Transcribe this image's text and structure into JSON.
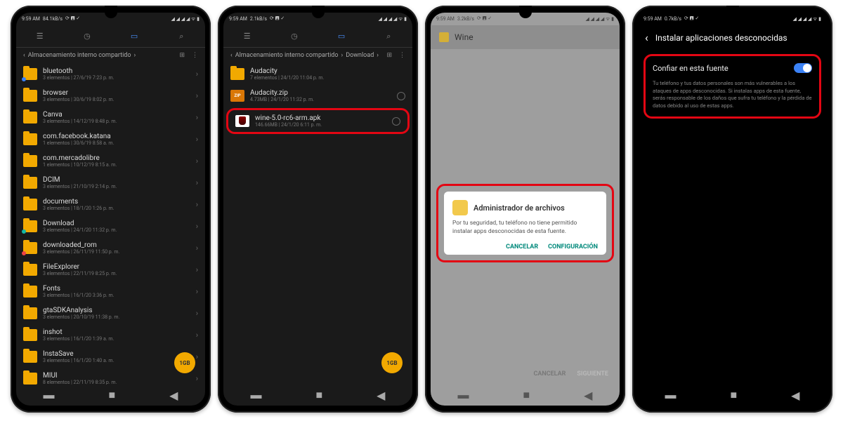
{
  "status": {
    "time": "9:59 AM",
    "net1": "84.1kB/s",
    "net2": "2.1kB/s",
    "net3": "3.2kB/s",
    "net4": "0.7kB/s"
  },
  "breadcrumb": {
    "arrow": "‹",
    "root": "Almacenamiento interno compartido",
    "chev": "›",
    "download": "Download"
  },
  "p1_list": [
    {
      "name": "bluetooth",
      "meta": "3 elementos | 27/6/19 7:23 p. m.",
      "badge": "blue"
    },
    {
      "name": "browser",
      "meta": "3 elementos | 30/6/19 8:02 p. m."
    },
    {
      "name": "Canva",
      "meta": "3 elementos | 14/12/19 8:48 p. m."
    },
    {
      "name": "com.facebook.katana",
      "meta": "1 elementos | 30/6/19 8:58 a. m."
    },
    {
      "name": "com.mercadolibre",
      "meta": "1 elementos | 10/12/19 8:15 a. m."
    },
    {
      "name": "DCIM",
      "meta": "3 elementos | 21/10/19 2:14 p. m."
    },
    {
      "name": "documents",
      "meta": "3 elementos | 18/1/20 1:26 p. m."
    },
    {
      "name": "Download",
      "meta": "3 elementos | 24/1/20 11:32 p. m.",
      "badge": "teal"
    },
    {
      "name": "downloaded_rom",
      "meta": "3 elementos | 26/11/19 11:50 p. m.",
      "badge": "red"
    },
    {
      "name": "FileExplorer",
      "meta": "3 elementos | 22/11/19 8:25 p. m."
    },
    {
      "name": "Fonts",
      "meta": "3 elementos | 16/1/20 3:36 p. m."
    },
    {
      "name": "gtaSDKAnalysis",
      "meta": "3 elementos | 20/10/19 11:38 p. m."
    },
    {
      "name": "inshot",
      "meta": "3 elementos | 16/1/20 1:39 a. m."
    },
    {
      "name": "InstaSave",
      "meta": "3 elementos | 16/1/20 1:40 a. m."
    },
    {
      "name": "MIUI",
      "meta": "8 elementos | 22/11/19 8:35 p. m."
    }
  ],
  "p2_list": [
    {
      "name": "Audacity",
      "meta": "7 elementos | 24/1/20 11:04 p. m.",
      "icon": "folder",
      "radio": false
    },
    {
      "name": "Audacity.zip",
      "meta": "4.73MB | 24/1/20 11:32 p. m.",
      "icon": "zip",
      "radio": true
    },
    {
      "name": "wine-5.0-rc6-arm.apk",
      "meta": "146.66MB | 24/1/20 6:11 p. m.",
      "icon": "apk",
      "radio": true,
      "highlight": true
    }
  ],
  "fab": "1GB",
  "p3": {
    "wine_title": "Wine",
    "dialog_title": "Administrador de archivos",
    "dialog_body": "Por tu seguridad, tu teléfono no tiene permitido instalar apps desconocidas de esta fuente.",
    "cancel": "CANCELAR",
    "config": "CONFIGURACIÓN",
    "bottom_cancel": "CANCELAR",
    "bottom_next": "SIGUIENTE"
  },
  "p4": {
    "title": "Instalar aplicaciones desconocidas",
    "trust": "Confiar en esta fuente",
    "desc": "Tu teléfono y tus datos personales son más vulnerables a los ataques de apps desconocidas. Si instalas apps de esta fuente, serás responsable de los daños que sufra tu teléfono y la pérdida de datos debido al uso de estas apps."
  }
}
